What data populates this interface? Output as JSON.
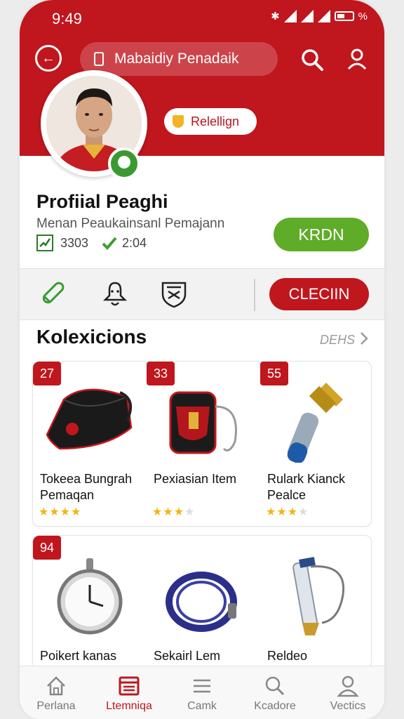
{
  "status_bar": {
    "time": "9:49",
    "battery": "%"
  },
  "header": {
    "title": "Mabaidiy Penadaik"
  },
  "profile": {
    "badge": "Relellign",
    "name": "Profiial Peaghi",
    "subtitle": "Menan Peaukainsanl Pemajann",
    "stat_count": "3303",
    "stat_time": "2:04",
    "primary_button": "KRDN"
  },
  "toolbar": {
    "action_button": "CLECIIN"
  },
  "section": {
    "title": "Kolexicions",
    "see_all": "DEHS"
  },
  "collection": {
    "row1": [
      {
        "number": "27",
        "name": "Tokeea Bungrah Pemaqan",
        "rating": 4,
        "art": "black-bag"
      },
      {
        "number": "33",
        "name": "Pexiasian Item",
        "rating": 3,
        "art": "red-pouch"
      },
      {
        "number": "55",
        "name": "Rulark Kianck Pealce",
        "rating": 3,
        "art": "torch"
      }
    ],
    "row2": [
      {
        "number": "94",
        "name": "Poikert kanas",
        "art": "pocket-watch"
      },
      {
        "number": "",
        "name": "Sekairl Lem",
        "art": "cable"
      },
      {
        "number": "",
        "name": "Reldeo",
        "art": "whistle-tube"
      }
    ]
  },
  "bottom_nav": [
    {
      "label": "Perlana",
      "icon": "home-icon"
    },
    {
      "label": "Ltemniqa",
      "icon": "collection-icon",
      "active": true
    },
    {
      "label": "Camk",
      "icon": "list-icon"
    },
    {
      "label": "Kcadore",
      "icon": "search-icon"
    },
    {
      "label": "Vectics",
      "icon": "user-icon"
    }
  ],
  "colors": {
    "brand": "#c0161d",
    "primary_green": "#5fac28",
    "star": "#f3b413"
  }
}
